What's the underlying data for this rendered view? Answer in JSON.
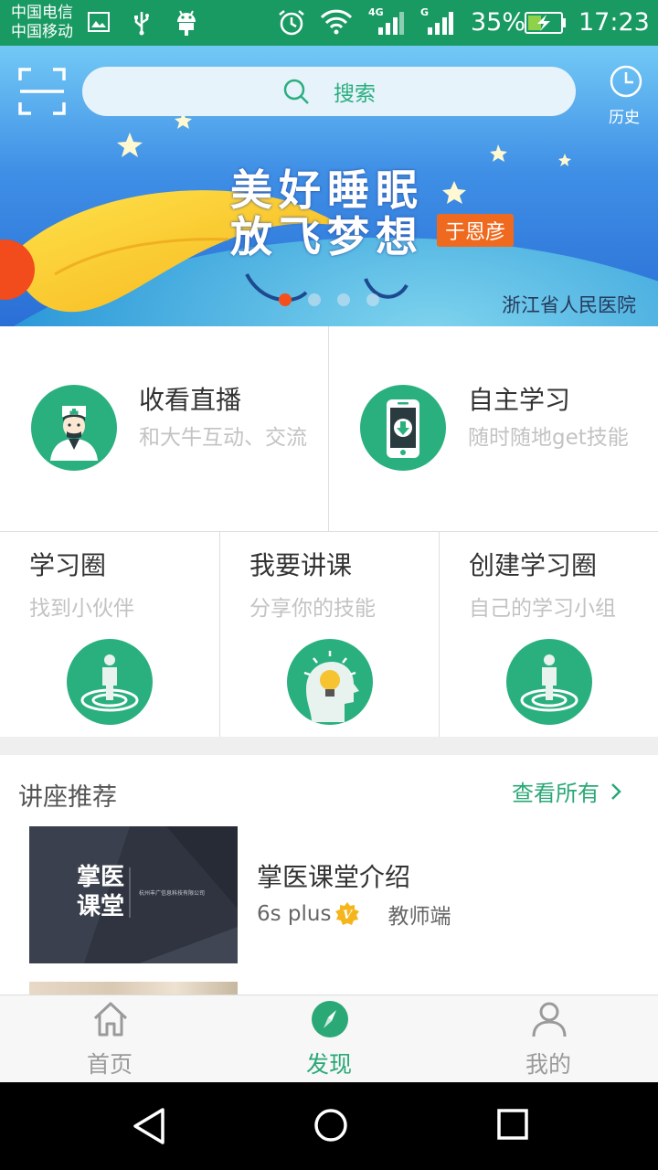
{
  "status_bar": {
    "carrier_1": "中国电信",
    "carrier_2": "中国移动",
    "network_1": "4G",
    "network_2": "G",
    "battery": "35%",
    "time": "17:23"
  },
  "banner": {
    "search_placeholder": "搜索",
    "history_label": "历史",
    "title_line_1": "美好睡眠",
    "title_line_2": "放飞梦想",
    "author": "于恩彦",
    "hospital": "浙江省人民医院",
    "slide_count": 4,
    "active_slide": 1
  },
  "features": {
    "live": {
      "title": "收看直播",
      "subtitle": "和大牛互动、交流"
    },
    "self_study": {
      "title": "自主学习",
      "subtitle": "随时随地get技能"
    },
    "study_circle": {
      "title": "学习圈",
      "subtitle": "找到小伙伴"
    },
    "teach": {
      "title": "我要讲课",
      "subtitle": "分享你的技能"
    },
    "create_circle": {
      "title": "创建学习圈",
      "subtitle": "自己的学习小组"
    }
  },
  "lectures": {
    "section_title": "讲座推荐",
    "see_all": "查看所有",
    "items": [
      {
        "thumb_title_1": "掌医",
        "thumb_title_2": "课堂",
        "thumb_company": "杭州丰广信息科技有限公司",
        "title": "掌医课堂介绍",
        "author": "6s plus",
        "role": "教师端"
      }
    ]
  },
  "tabbar": {
    "home": "首页",
    "discover": "发现",
    "mine": "我的",
    "active": "discover"
  },
  "colors": {
    "accent_green": "#2aa876",
    "status_bar_green": "#1a9a63",
    "author_tag_orange": "#ef6a1f"
  }
}
